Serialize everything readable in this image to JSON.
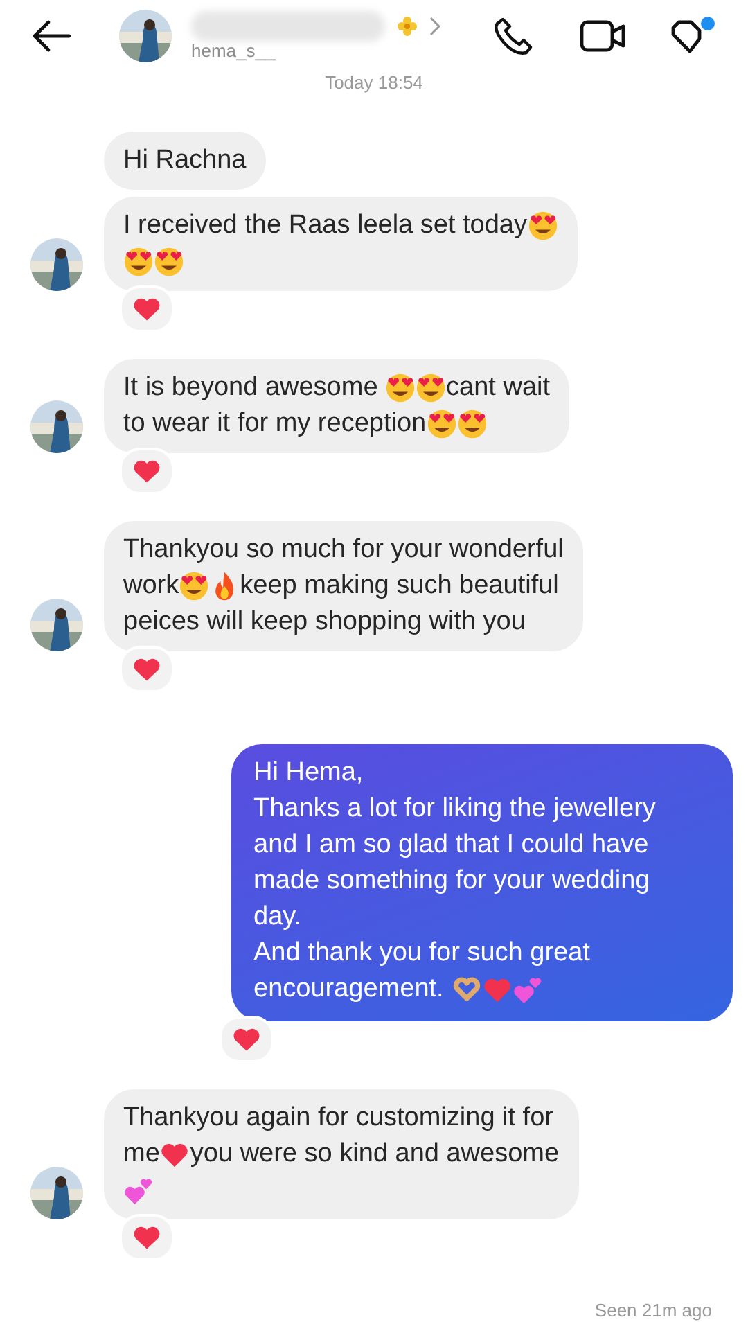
{
  "header": {
    "username": "hema_s__",
    "timestamp": "Today 18:54"
  },
  "messages": [
    {
      "kind": "incoming",
      "avatar": false,
      "reacted": false,
      "lines": [
        [
          {
            "kind": "text",
            "text": "Hi Rachna"
          }
        ]
      ]
    },
    {
      "kind": "incoming",
      "avatar": true,
      "reacted": true,
      "lines": [
        [
          {
            "kind": "text",
            "text": "I received the Raas leela set today"
          },
          {
            "kind": "heart-eyes"
          }
        ],
        [
          {
            "kind": "heart-eyes"
          },
          {
            "kind": "heart-eyes"
          }
        ]
      ]
    },
    {
      "kind": "incoming",
      "avatar": true,
      "reacted": true,
      "lines": [
        [
          {
            "kind": "text",
            "text": "It is beyond awesome "
          },
          {
            "kind": "heart-eyes"
          },
          {
            "kind": "heart-eyes"
          },
          {
            "kind": "text",
            "text": "cant wait"
          }
        ],
        [
          {
            "kind": "text",
            "text": "to wear it for my reception"
          },
          {
            "kind": "heart-eyes"
          },
          {
            "kind": "heart-eyes"
          }
        ]
      ]
    },
    {
      "kind": "incoming",
      "avatar": true,
      "reacted": true,
      "lines": [
        [
          {
            "kind": "text",
            "text": "Thankyou so much for your wonderful"
          }
        ],
        [
          {
            "kind": "text",
            "text": "work"
          },
          {
            "kind": "heart-eyes"
          },
          {
            "kind": "fire"
          },
          {
            "kind": "text",
            "text": "keep making such beautiful"
          }
        ],
        [
          {
            "kind": "text",
            "text": "peices will keep shopping with you"
          }
        ]
      ]
    },
    {
      "kind": "outgoing",
      "reacted": true,
      "lines": [
        [
          {
            "kind": "text",
            "text": "Hi Hema,"
          }
        ],
        [
          {
            "kind": "text",
            "text": "Thanks a lot for liking the jewellery"
          }
        ],
        [
          {
            "kind": "text",
            "text": "and I am so glad that I could have"
          }
        ],
        [
          {
            "kind": "text",
            "text": "made something for your wedding"
          }
        ],
        [
          {
            "kind": "text",
            "text": "day."
          }
        ],
        [
          {
            "kind": "text",
            "text": "And thank you for such great"
          }
        ],
        [
          {
            "kind": "text",
            "text": "encouragement. "
          },
          {
            "kind": "heart-hands"
          },
          {
            "kind": "heart"
          },
          {
            "kind": "two-hearts"
          }
        ]
      ]
    },
    {
      "kind": "incoming",
      "avatar": true,
      "reacted": true,
      "lines": [
        [
          {
            "kind": "text",
            "text": "Thankyou again for customizing it for"
          }
        ],
        [
          {
            "kind": "text",
            "text": "me"
          },
          {
            "kind": "heart"
          },
          {
            "kind": "text",
            "text": "you were so kind and awesome"
          }
        ],
        [
          {
            "kind": "two-hearts"
          }
        ]
      ]
    }
  ],
  "footer": {
    "seen": "Seen 21m ago"
  }
}
